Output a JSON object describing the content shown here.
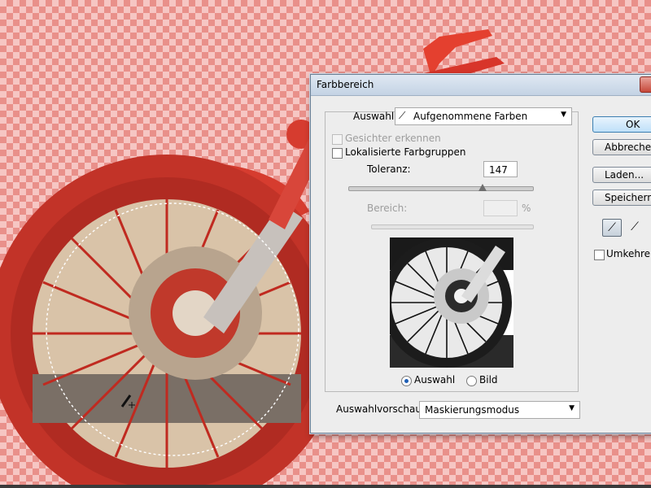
{
  "dialog": {
    "title": "Farbbereich",
    "auswahl_label": "Auswahl:",
    "auswahl_value": "Aufgenommene Farben",
    "gesichter_label": "Gesichter erkennen",
    "lokalisiert_label": "Lokalisierte Farbgruppen",
    "toleranz_label": "Toleranz:",
    "toleranz_value": "147",
    "toleranz_fraction": 0.73,
    "bereich_label": "Bereich:",
    "bereich_unit": "%",
    "radio_auswahl": "Auswahl",
    "radio_bild": "Bild",
    "vorschau_label": "Auswahlvorschau:",
    "vorschau_value": "Maskierungsmodus"
  },
  "buttons": {
    "ok": "OK",
    "abbrechen": "Abbrechen",
    "laden": "Laden...",
    "speichern": "Speichern..."
  },
  "checkbox_umkehren": "Umkehren",
  "icons": {
    "eyedropper": "eyedropper-icon",
    "eyedropper_plus": "eyedropper-plus-icon",
    "eyedropper_minus": "eyedropper-minus-icon",
    "close": "close-icon",
    "dropdown_arrow": "chevron-down-icon"
  },
  "colors": {
    "mask_overlay": "#cf2a1f",
    "checker_light": "#f6c6c3",
    "checker_dark": "#e9908a",
    "dialog_bg": "#ededed"
  }
}
